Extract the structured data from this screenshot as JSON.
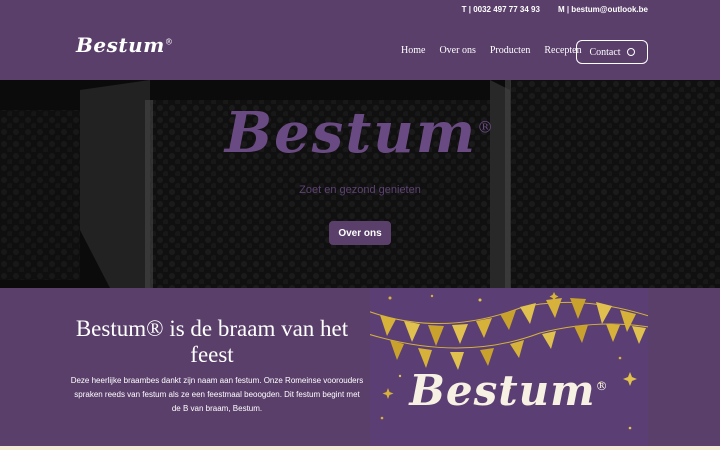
{
  "topbar": {
    "phone": "T | 0032 497 77 34 93",
    "email": "M | bestum@outlook.be"
  },
  "logo": {
    "text": "Bestum",
    "mark": "®"
  },
  "nav": {
    "items": [
      "Home",
      "Over ons",
      "Producten",
      "Recepten"
    ],
    "contact_label": "Contact",
    "contact_icon": "chat-icon"
  },
  "hero": {
    "logo_text": "Bestum",
    "logo_mark": "®",
    "tagline": "Zoet en gezond genieten",
    "button_label": "Over ons"
  },
  "intro": {
    "title": "Bestum® is de braam van het feest",
    "body": "Deze heerlijke braambes dankt zijn naam aan festum. Onze Romeinse voorouders spraken reeds van festum als ze een feestmaal beoogden. Dit festum begint met de B van braam, Bestum."
  },
  "promo": {
    "logo_text": "Bestum",
    "logo_mark": "®"
  },
  "colors": {
    "brand_purple": "#5a3f6b",
    "promo_purple": "#5b3f74",
    "gold": "#d6b23a",
    "cream": "#f3ecd6"
  }
}
